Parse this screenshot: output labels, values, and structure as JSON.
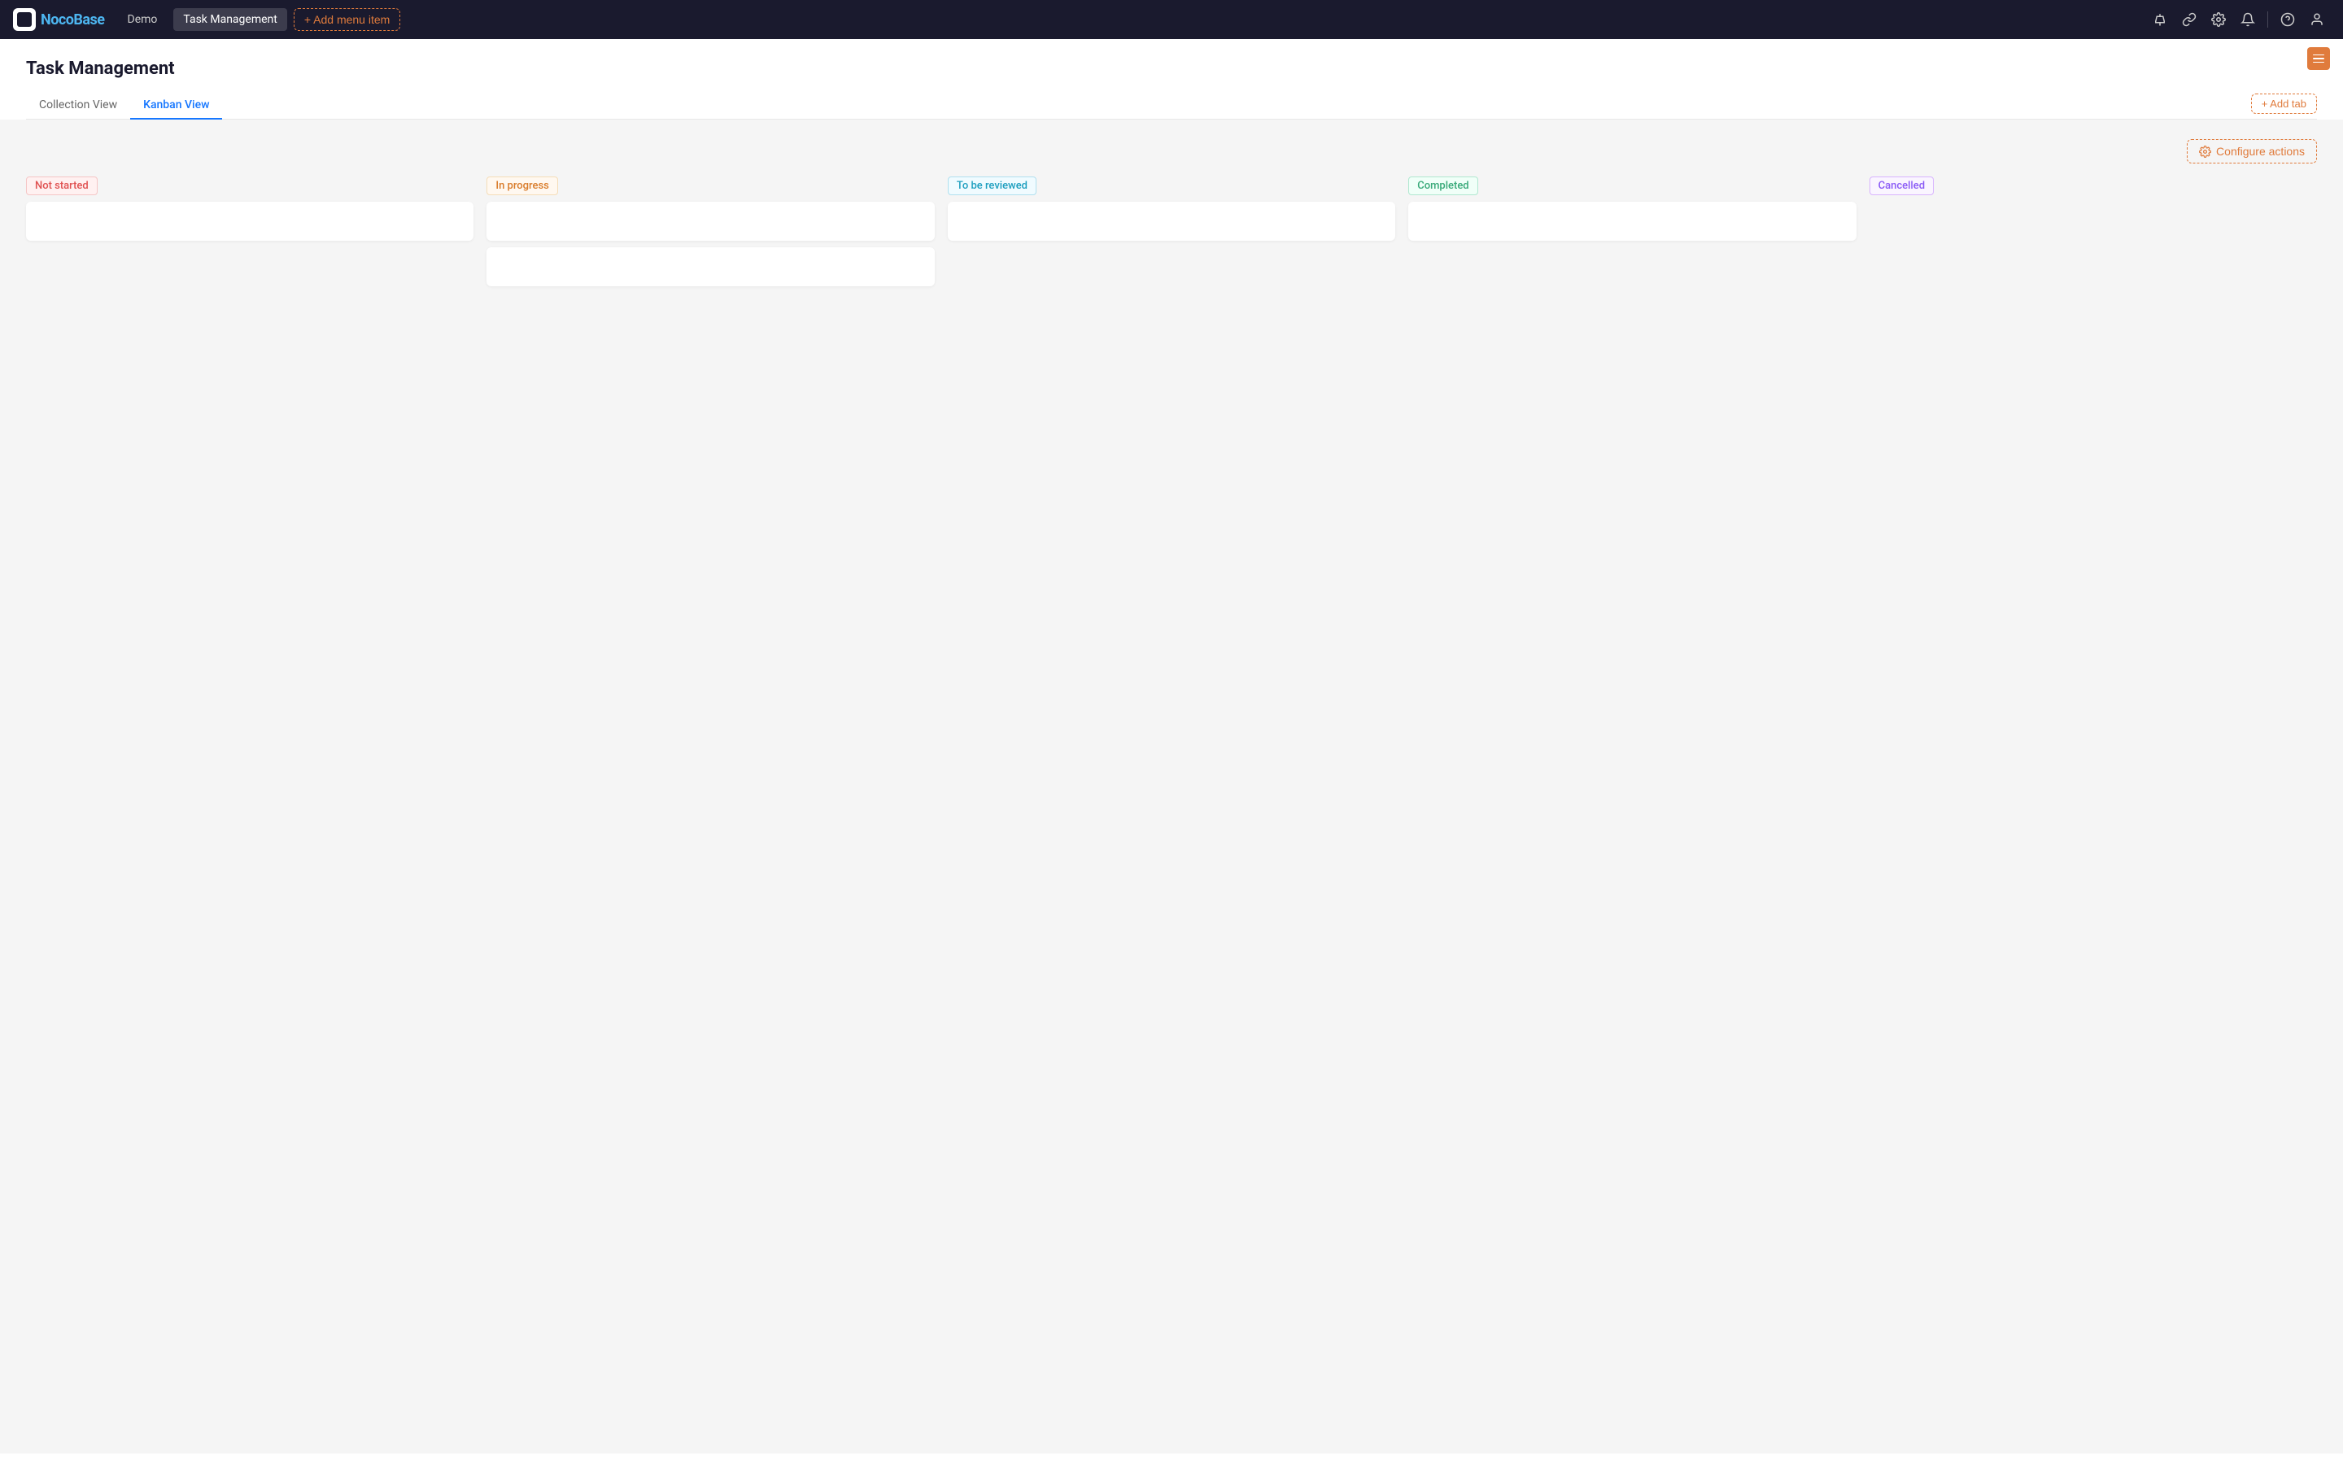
{
  "app": {
    "brand": {
      "noco": "Noco",
      "base": "Base"
    },
    "logo_alt": "NocoBase Logo"
  },
  "navbar": {
    "demo_label": "Demo",
    "task_management_label": "Task Management",
    "add_menu_item_label": "+ Add menu item",
    "icons": {
      "pin": "📌",
      "link": "🔗",
      "settings": "⚙",
      "bell": "🔔",
      "help": "❓",
      "user": "👤"
    }
  },
  "page": {
    "title": "Task Management"
  },
  "tabs": {
    "collection_view": "Collection View",
    "kanban_view": "Kanban View",
    "add_tab": "+ Add tab"
  },
  "toolbar": {
    "configure_actions": "Configure actions"
  },
  "kanban": {
    "columns": [
      {
        "id": "not-started",
        "label": "Not started",
        "badge_class": "badge-red",
        "cards": [
          {}
        ]
      },
      {
        "id": "in-progress",
        "label": "In progress",
        "badge_class": "badge-orange",
        "cards": [
          {},
          {}
        ]
      },
      {
        "id": "to-be-reviewed",
        "label": "To be reviewed",
        "badge_class": "badge-cyan",
        "cards": [
          {}
        ]
      },
      {
        "id": "completed",
        "label": "Completed",
        "badge_class": "badge-green",
        "cards": [
          {}
        ]
      },
      {
        "id": "cancelled",
        "label": "Cancelled",
        "badge_class": "badge-purple",
        "cards": []
      }
    ]
  }
}
